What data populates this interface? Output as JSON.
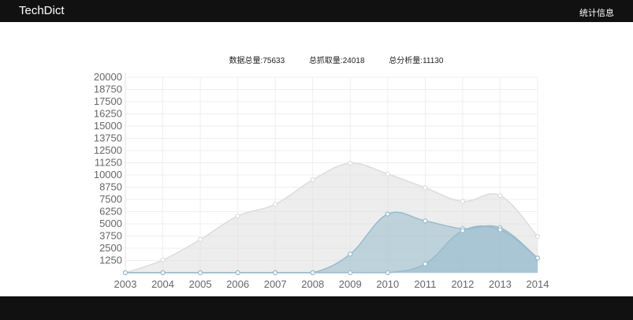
{
  "navbar": {
    "brand": "TechDict",
    "link": "统计信息",
    "background": "#111111"
  },
  "stats": {
    "total": "数据总量:75633",
    "crawled": "总抓取量:24018",
    "analyzed": "总分析量:11130"
  },
  "chart_data": {
    "type": "area",
    "x": [
      "2003",
      "2004",
      "2005",
      "2006",
      "2007",
      "2008",
      "2009",
      "2010",
      "2011",
      "2012",
      "2013",
      "2014"
    ],
    "ylim": [
      0,
      20000
    ],
    "yticks": [
      1250,
      2500,
      3750,
      5000,
      6250,
      7500,
      8750,
      10000,
      11250,
      12500,
      13750,
      15000,
      16250,
      17500,
      18750,
      20000
    ],
    "grid": true,
    "series": [
      {
        "values": [
          0,
          1300,
          3400,
          5800,
          7000,
          9500,
          11200,
          10100,
          8700,
          7300,
          7900,
          3700
        ],
        "color": "#dcdcdc"
      },
      {
        "values": [
          0,
          0,
          0,
          0,
          0,
          0,
          1900,
          6000,
          5300,
          4500,
          4600,
          1500
        ],
        "color": "#97bbcd"
      },
      {
        "values": [
          0,
          0,
          0,
          0,
          0,
          0,
          0,
          0,
          900,
          4300,
          4400,
          1500
        ],
        "color": "#97bbcd"
      }
    ]
  }
}
